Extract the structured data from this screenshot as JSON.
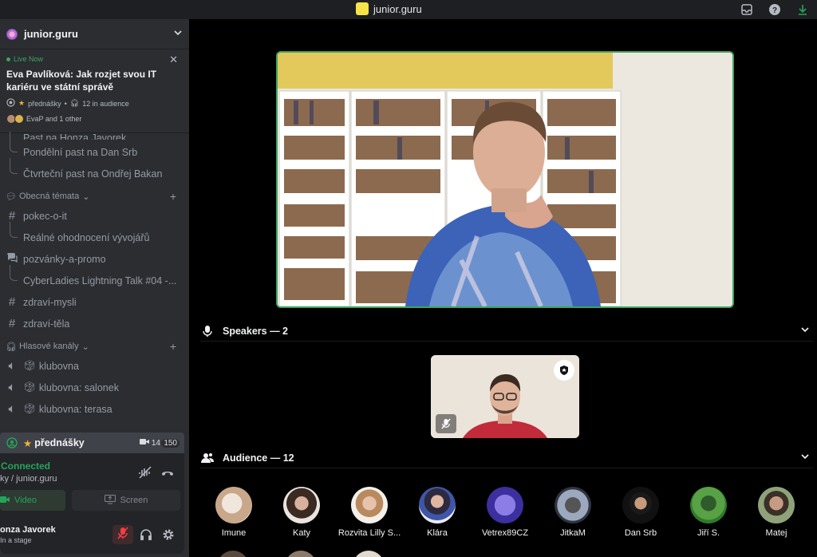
{
  "window": {
    "title": "junior.guru"
  },
  "server": {
    "name": "junior.guru"
  },
  "live": {
    "status": "Live Now",
    "title": "Eva Pavlíková: Jak rozjet svou IT kariéru ve státní správě",
    "channel": "přednášky",
    "audience": "12 in audience",
    "users": "EvaP and 1 other"
  },
  "channels": {
    "partial_thread": "Past na Honza Javorek...",
    "threads_top": [
      "Pondělní past na Dan Srb",
      "Čtvrteční past na Ondřej Bakan"
    ],
    "cat_general": "Obecná témata",
    "pokec": "pokec-o-it",
    "pokec_thread": "Reálné ohodnocení vývojářů",
    "pozvanky": "pozvánky-a-promo",
    "pozvanky_thread": "CyberLadies Lightning Talk #04 -...",
    "zdravi_mysli": "zdraví-mysli",
    "zdravi_tela": "zdraví-těla",
    "cat_voice": "Hlasové kanály",
    "voice": [
      "klubovna",
      "klubovna: salonek",
      "klubovna: terasa"
    ],
    "active": "přednášky",
    "active_cam": "14",
    "active_count": "150"
  },
  "voice_panel": {
    "status": "Connected",
    "location": "ky / junior.guru",
    "video_label": "Video",
    "screen_label": "Screen",
    "user_name": "onza Javorek",
    "user_status": "In a stage"
  },
  "stage": {
    "speakers_header": "Speakers — 2",
    "audience_header": "Audience — 12",
    "audience": [
      "Imune",
      "Katy",
      "Rozvita Lilly S...",
      "Klára",
      "Vetrex89CZ",
      "JitkaM",
      "Dan Srb",
      "Jiří S.",
      "Matej"
    ]
  },
  "colors": {
    "accent_green": "#3ba55d",
    "sidebar": "#2b2d31",
    "panel": "#232428"
  }
}
